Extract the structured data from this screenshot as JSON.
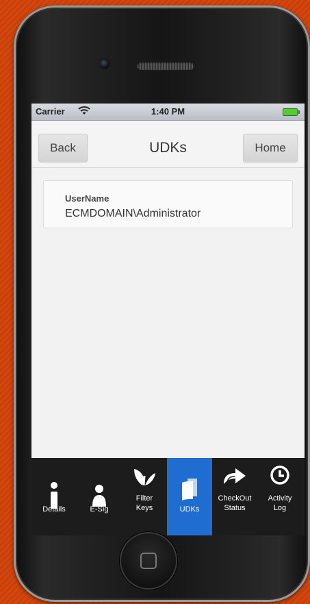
{
  "status_bar": {
    "carrier": "Carrier",
    "time": "1:40 PM"
  },
  "navbar": {
    "back_label": "Back",
    "title": "UDKs",
    "home_label": "Home"
  },
  "udk": {
    "label": "UserName",
    "value": "ECMDOMAIN\\Administrator"
  },
  "tabs": [
    {
      "icon": "info-icon",
      "lines": [
        "Details"
      ]
    },
    {
      "icon": "person-icon",
      "lines": [
        "E-Sig"
      ]
    },
    {
      "icon": "filter-keys-icon",
      "lines": [
        "Filter",
        "Keys"
      ]
    },
    {
      "icon": "documents-icon",
      "lines": [
        "UDKs"
      ],
      "active": true
    },
    {
      "icon": "share-arrow-icon",
      "lines": [
        "CheckOut",
        "Status"
      ]
    },
    {
      "icon": "clock-icon",
      "lines": [
        "Activity",
        "Log"
      ]
    }
  ],
  "colors": {
    "tab_active": "#1f6dd0",
    "tab_bar": "#1c1c1c",
    "background": "#d2480f"
  }
}
